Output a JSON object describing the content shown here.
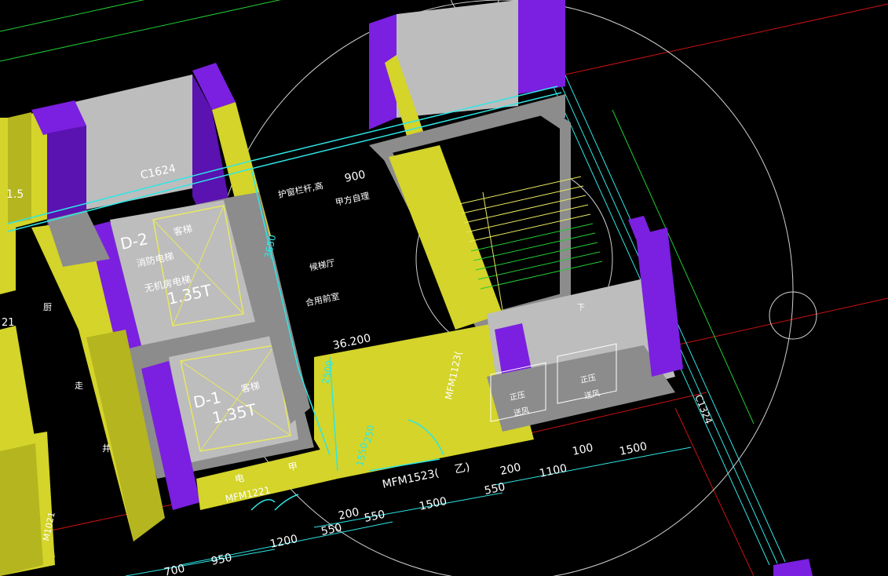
{
  "colors": {
    "background": "#000000",
    "wall_yellow": "#d4d42a",
    "wall_yellow_side": "#b5b520",
    "wall_purple": "#7b1fe0",
    "wall_purple_dark": "#5a12b0",
    "room_gray": "#bdbdbd",
    "slab_gray": "#8c8c8c",
    "cyan_line": "#2ee6e6",
    "green_line": "#22cc33",
    "red_line": "#cc1111",
    "white_line": "#e0e0e0"
  },
  "labels": {
    "window_c1624": "C1624",
    "window_c1324": "C1324",
    "railing": "护窗栏杆,高",
    "railing_height": "900",
    "owner_managed": "甲方自理",
    "dim_3650": "3650",
    "elevator_hall": "候梯厅",
    "shared_front": "合用前室",
    "elevator_2_id": "D-2",
    "elevator_2_type": "客梯",
    "fire_elevator": "消防电梯",
    "no_machine_room": "无机房电梯",
    "elevator_2_load": "1.35T",
    "elevator_1_id": "D-1",
    "elevator_1_type": "客梯",
    "elevator_1_load": "1.35T",
    "level": "36.200",
    "dim_2500": "2500",
    "door_mfm1123": "MFM1123(",
    "pressurized_1": "正压",
    "air_supply_1": "送风",
    "pressurized_2": "正压",
    "air_supply_2": "送风",
    "down": "下",
    "electrical": "电",
    "armor": "甲",
    "door_mfm1221": "MFM1221",
    "door_mfm1523": "MFM1523(",
    "grade_yi": "乙)",
    "dim_1550": "1550",
    "dim_250": "250",
    "dim_1_5": "1.5",
    "side_1": "厨",
    "side_2": "走",
    "side_3": "井",
    "side_num_21": "21",
    "side_code": "M1021"
  },
  "dimensions_row1": [
    "200",
    "1100",
    "100",
    "1500"
  ],
  "dimensions_row2": [
    "550",
    "1500"
  ],
  "dimensions_row3": [
    "200",
    "550"
  ],
  "dimensions_row4": [
    "1200",
    "550"
  ],
  "dimensions_row5": [
    "700",
    "950"
  ]
}
